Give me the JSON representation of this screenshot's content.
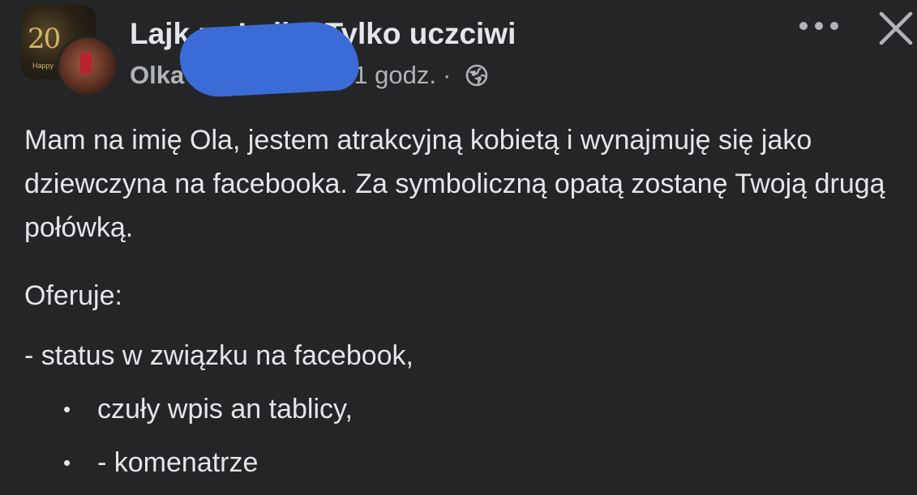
{
  "post": {
    "group_name": "Lajk za Lajk ! Tylko uczciwi",
    "author": "Olka",
    "time": "1 godz.",
    "separator": "·",
    "privacy_icon": "globe-icon",
    "more_icon": "more-dots-icon",
    "close_icon": "close-icon",
    "group_avatar_text": "20",
    "group_avatar_small_text": "Happy"
  },
  "body": {
    "paragraph": "Mam na imię Ola, jestem atrakcyjną kobietą i wynajmuję się jako dziewczyna na facebooka. Za symboliczną opatą zostanę Twoją drugą połówką.",
    "offer_title": "Oferuje:",
    "offer_first": "- status w związku na facebook,",
    "bullets": [
      {
        "marker": "•",
        "text": "czuły wpis an tablicy,"
      },
      {
        "marker": "•",
        "text": "- komenatrze"
      }
    ]
  },
  "colors": {
    "background": "#242526",
    "primary_text": "#e4e6eb",
    "secondary_text": "#b0b3b8",
    "censor_blue": "#3b6bd6"
  }
}
